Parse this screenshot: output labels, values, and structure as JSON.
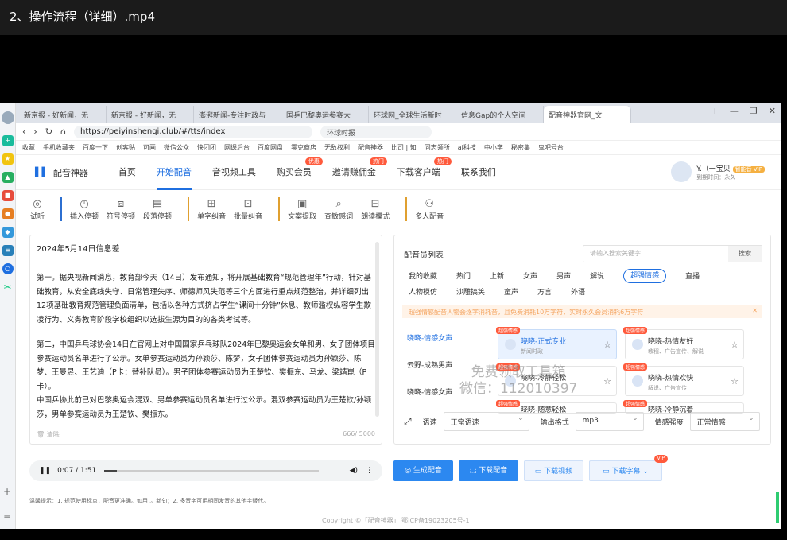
{
  "player": {
    "title": "2、操作流程（详细）.mp4"
  },
  "browser": {
    "tabs": [
      "新京报 - 好新闻，无",
      "新京报 - 好新闻，无",
      "澎湃新闻-专注时政与",
      "国乒巴黎奥运参赛大",
      "环球网_全球生活新时",
      "信息Gap的个人空间",
      "配音神器官网_文"
    ],
    "url": "https://peiyinshenqi.club/#/tts/index",
    "search": "环球时报",
    "bookmarks": [
      "收藏",
      "手机收藏夹",
      "百度一下",
      "创客贴",
      "可画",
      "微信公众",
      "快团团",
      "网课后台",
      "百度网盘",
      "零克商店",
      "无敌权利",
      "配音神器",
      "比司 | 知",
      "同志领所",
      "ai科技",
      "中小学",
      "秘密集",
      "鬼吧号台"
    ]
  },
  "site": {
    "logo": "配音神器",
    "nav": [
      {
        "label": "首页",
        "badge": ""
      },
      {
        "label": "开始配音",
        "badge": ""
      },
      {
        "label": "音视频工具",
        "badge": ""
      },
      {
        "label": "购买会员",
        "badge": "优惠"
      },
      {
        "label": "邀请赚佣金",
        "badge": "热门"
      },
      {
        "label": "下载客户端",
        "badge": "热门"
      },
      {
        "label": "联系我们",
        "badge": ""
      }
    ],
    "user": {
      "name": "Y.（一宝贝",
      "vip": "智能音 VIP",
      "expiry": "到期时间：永久"
    }
  },
  "toolbar": {
    "groups": [
      [
        "试听"
      ],
      [
        "插入停顿",
        "符号停顿",
        "段落停顿"
      ],
      [
        "单字纠音",
        "批量纠音"
      ],
      [
        "文案提取",
        "查敏感词",
        "朗读模式"
      ],
      [
        "多人配音"
      ]
    ]
  },
  "editor": {
    "title": "2024年5月14日信息差",
    "paragraphs": [
      "第一。据央视新闻消息，教育部今天（14日）发布通知，将开展基础教育“规范管理年”行动，针对基础教育，从安全底线失守、日常管理失序、师德师风失范等三个方面进行重点规范整治，并详细列出12项基础教育规范管理负面清单，包括以各种方式挤占学生“课间十分钟”休息、教师滥权纵容学生欺凌行为、义务教育阶段学校组织以选拔生源为目的的各类考试等。",
      "第二，中国乒乓球协会14日在官网上对中国国家乒乓球队2024年巴黎奥运会女单和男、女子团体项目参赛运动员名单进行了公示。女单参赛运动员为孙颖莎、陈梦，女子团体参赛运动员为孙颖莎、陈梦、王曼昱、王艺迪（P卡：替补队员）。男子团体参赛运动员为王楚钦、樊振东、马龙、梁靖崑（P卡）。",
      "中国乒协此前已对巴黎奥运会混双、男单参赛运动员名单进行过公示。混双参赛运动员为王楚钦/孙颖莎，男单参赛运动员为王楚钦、樊振东。"
    ],
    "clear": "清除",
    "count": "666/ 5000"
  },
  "voices": {
    "title": "配音员列表",
    "search_placeholder": "请输入搜索关键字",
    "search_btn": "搜索",
    "categories": [
      "我的收藏",
      "热门",
      "上新",
      "女声",
      "男声",
      "解说",
      "超强情感",
      "直播",
      "人物模仿",
      "沙雕搞笑",
      "童声",
      "方言",
      "外语"
    ],
    "active_category": "超强情感",
    "notice": "超强情感配音人物会逐字消耗音，且免费消耗10万字符，实时永久会员消耗6万字符",
    "list": [
      "晓晓-情感女声",
      "云野-成熟男声",
      "晓晓-情感女声"
    ],
    "cards": [
      {
        "tag": "超强情感",
        "name": "晓晓-正式专业",
        "desc": "新闻时政"
      },
      {
        "tag": "超强情感",
        "name": "晓晓-热情友好",
        "desc": "教程、广告宣传、解说"
      },
      {
        "tag": "超强情感",
        "name": "晓晓-冷静轻松",
        "desc": ""
      },
      {
        "tag": "超强情感",
        "name": "晓晓-热情欢快",
        "desc": "解说、广告宣传"
      },
      {
        "tag": "超强情感",
        "name": "晓晓-随意轻松",
        "desc": ""
      },
      {
        "tag": "超强情感",
        "name": "晓晓-冷静沉着",
        "desc": ""
      }
    ],
    "settings": {
      "speed_label": "语速",
      "speed": "正常语速",
      "format_label": "输出格式",
      "format": "mp3",
      "emotion_label": "情感强度",
      "emotion": "正常情感"
    }
  },
  "watermark": [
    "免费领取工具箱",
    "微信：112010397"
  ],
  "audio": {
    "time": "0:07 / 1:51",
    "progress": 0.06
  },
  "actions": {
    "generate": "生成配音",
    "download_audio": "下载配音",
    "download_video": "下载视频",
    "download_subtitle": "下载字幕",
    "vip": "VIP"
  },
  "tip": "温馨提示：1. 规范使用标点，配音更准确。如用，。新句；2. 多音字可用相同发音的其他字替代。",
  "copyright": "Copyright ©「配音神器」 鄂ICP备19023205号-1"
}
